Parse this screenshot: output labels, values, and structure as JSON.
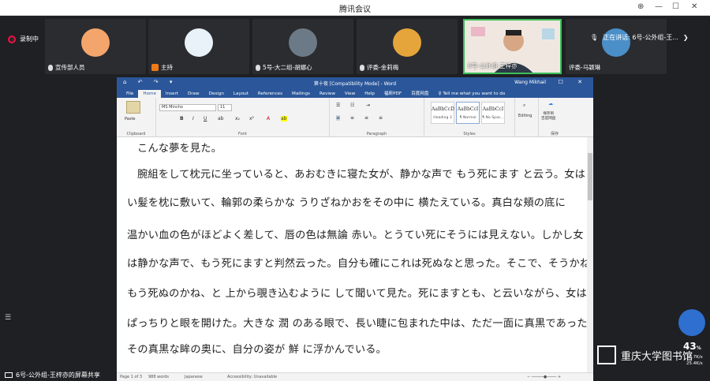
{
  "meeting": {
    "title": "腾讯会议",
    "recording": "录制中",
    "speaking": "正在讲话: 6号-公外组-王...",
    "share_label": "6号-公外组-王梓亦的屏幕共享",
    "participants": [
      {
        "name": "宣传部人员",
        "avatar_color": "#f4a56b"
      },
      {
        "name": "主持",
        "avatar_color": "#e8f2f8",
        "host": true
      },
      {
        "name": "5号-大二组-胡娜心",
        "avatar_color": "#6b7a86"
      },
      {
        "name": "评委-金莉梅",
        "avatar_color": "#e5a53b"
      },
      {
        "name": "6号-公外组-王梓亦",
        "video": true
      },
      {
        "name": "评委-马颖琳",
        "avatar_color": "#4a8fc8"
      }
    ]
  },
  "word": {
    "quick_access": "⌂ ↶ ↷ ▾",
    "doc_title": "第十夜 [Compatibility Mode] - Word",
    "user": "Wang Mikhail",
    "tabs": [
      "File",
      "Home",
      "Insert",
      "Draw",
      "Design",
      "Layout",
      "References",
      "Mailings",
      "Review",
      "View",
      "Help",
      "福昕PDF",
      "百度网盘",
      "♀ Tell me what you want to do"
    ],
    "active_tab": "Home",
    "ribbon": {
      "paste": "Paste",
      "clipboard": "Clipboard",
      "font_name": "MS Mincho",
      "font_size": "11",
      "font_group": "Font",
      "paragraph_group": "Paragraph",
      "styles_group": "Styles",
      "styles": [
        {
          "preview": "AaBbCcD",
          "name": "Heading 3"
        },
        {
          "preview": "AaBbCcI",
          "name": "¶ Normal"
        },
        {
          "preview": "AaBbCcI",
          "name": "¶ No Spac..."
        }
      ],
      "editing": "Editing",
      "baidu_save": "保存到\n百度网盘",
      "baidu_group": "保存"
    },
    "body_lines": [
      "こんな夢を見た。",
      "腕組をして枕元に坐っていると、あおむきに寝た女が、静かな声で もう死にます と云う。女は 長",
      "い髪を枕に敷いて、輪郭の柔らかな うりざねかおをその中に 横たえている。真白な頬の底に",
      "温かい血の色がほどよく差して、唇の色は無論 赤い。とうてい死にそうには見えない。しかし女",
      "は静かな声で、もう死にますと判然云った。自分も確にこれは死ぬなと思った。そこで、そうかね、",
      "もう死ぬのかね、と 上から覗き込むように して聞いて見た。死にますとも、と云いながら、女は",
      "ぱっちりと眼を開けた。大きな 潤 のある眼で、長い睫に包まれた中は、ただ一面に真黒であった。",
      "その真黒な眸の奥に、自分の姿が 鮮 に浮かんでいる。"
    ],
    "status": {
      "page": "Page 1 of 3",
      "words": "988 words",
      "lang": "Japanese",
      "access": "Accessibility: Unavailable"
    }
  },
  "overlay": {
    "logo": "重庆大学图书馆",
    "cpu": "43",
    "cpu_unit": "%",
    "up": "10.7K/s",
    "down": "25.4K/s"
  }
}
